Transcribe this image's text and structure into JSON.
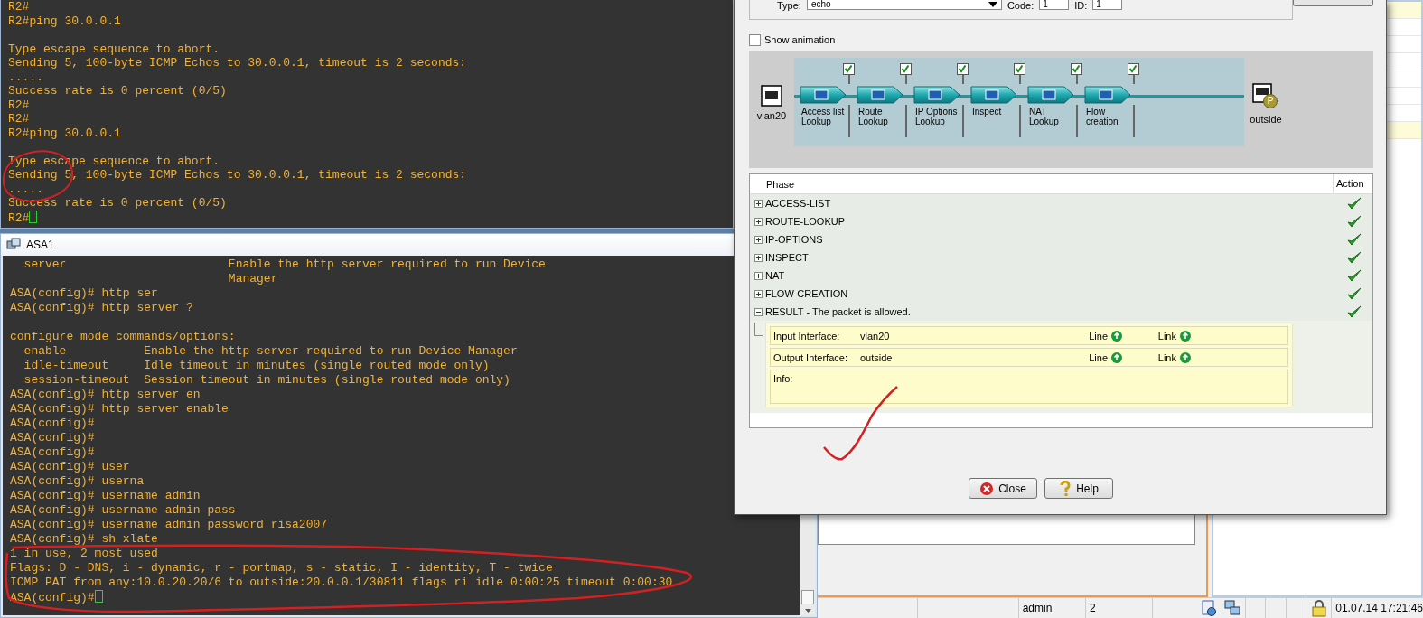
{
  "r2_terminal": {
    "cursor": true,
    "blocks": [
      [
        "R2#",
        "R2#ping 30.0.0.1"
      ],
      [
        "Type escape sequence to abort.",
        "Sending 5, 100-byte ICMP Echos to 30.0.0.1, timeout is 2 seconds:",
        ".....",
        "Success rate is 0 percent (0/5)",
        "R2#",
        "R2#",
        "R2#ping 30.0.0.1"
      ],
      [
        "Type escape sequence to abort.",
        "Sending 5, 100-byte ICMP Echos to 30.0.0.1, timeout is 2 seconds:",
        ".....",
        "Success rate is 0 percent (0/5)",
        "R2#"
      ]
    ]
  },
  "asa_window": {
    "title": "ASA1",
    "terminal": {
      "cursor": true,
      "blocks": [
        [
          "  server                       Enable the http server required to run Device",
          "                               Manager",
          "ASA(config)# http ser",
          "ASA(config)# http server ?"
        ],
        [
          "configure mode commands/options:",
          "  enable           Enable the http server required to run Device Manager",
          "  idle-timeout     Idle timeout in minutes (single routed mode only)",
          "  session-timeout  Session timeout in minutes (single routed mode only)",
          "ASA(config)# http server en",
          "ASA(config)# http server enable",
          "ASA(config)#",
          "ASA(config)#",
          "ASA(config)#",
          "ASA(config)# user",
          "ASA(config)# userna",
          "ASA(config)# username admin",
          "ASA(config)# username admin pass",
          "ASA(config)# username admin password risa2007",
          "ASA(config)# sh xlate",
          "1 in use, 2 most used",
          "Flags: D - DNS, i - dynamic, r - portmap, s - static, I - identity, T - twice",
          "ICMP PAT from any:10.0.20.20/6 to outside:20.0.0.1/30811 flags ri idle 0:00:25 timeout 0:00:30",
          "ASA(config)#"
        ]
      ]
    }
  },
  "trace_dialog": {
    "type_label": "Type:",
    "type_value": "echo",
    "code_label": "Code:",
    "code_value": "1",
    "id_label": "ID:",
    "id_value": "1",
    "show_animation": {
      "label": "Show animation",
      "checked": false
    },
    "flow": {
      "source": "vlan20",
      "destination": "outside",
      "destination_badge": "P",
      "stages": [
        {
          "label": "Access list Lookup",
          "checked": true
        },
        {
          "label": "Route Lookup",
          "checked": true
        },
        {
          "label": "IP Options Lookup",
          "checked": true
        },
        {
          "label": "Inspect",
          "checked": true
        },
        {
          "label": "NAT Lookup",
          "checked": true
        },
        {
          "label": "Flow creation",
          "checked": true
        }
      ]
    },
    "phases": {
      "columns": [
        "Phase",
        "Action"
      ],
      "rows": [
        {
          "name": "ACCESS-LIST",
          "expanded": false,
          "allowed": true
        },
        {
          "name": "ROUTE-LOOKUP",
          "expanded": false,
          "allowed": true
        },
        {
          "name": "IP-OPTIONS",
          "expanded": false,
          "allowed": true
        },
        {
          "name": "INSPECT",
          "expanded": false,
          "allowed": true
        },
        {
          "name": "NAT",
          "expanded": false,
          "allowed": true
        },
        {
          "name": "FLOW-CREATION",
          "expanded": false,
          "allowed": true
        },
        {
          "name": "RESULT - The packet is allowed.",
          "expanded": true,
          "allowed": true
        }
      ]
    },
    "result": {
      "interfaces": [
        {
          "label": "Input Interface:",
          "value": "vlan20",
          "line_label": "Line",
          "link_label": "Link"
        },
        {
          "label": "Output Interface:",
          "value": "outside",
          "line_label": "Line",
          "link_label": "Link"
        }
      ],
      "info_label": "Info:"
    },
    "buttons": [
      {
        "label": "Close",
        "kind": "close"
      },
      {
        "label": "Help",
        "kind": "help"
      }
    ]
  },
  "status_bar": {
    "user": "admin",
    "count": "2",
    "datetime": "01.07.14 17:21:46"
  }
}
